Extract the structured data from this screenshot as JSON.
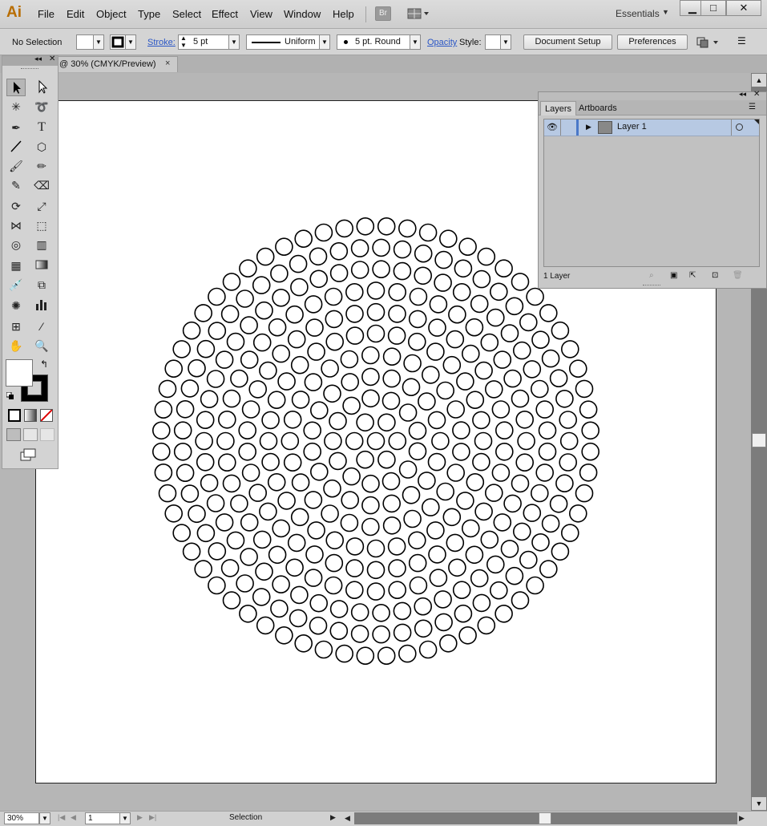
{
  "app": {
    "logo": "Ai",
    "menu": [
      "File",
      "Edit",
      "Object",
      "Type",
      "Select",
      "Effect",
      "View",
      "Window",
      "Help"
    ],
    "bridge_label": "Br",
    "workspace": "Essentials",
    "window_buttons": [
      "minimize-icon",
      "maximize-icon",
      "close-icon"
    ]
  },
  "controlbar": {
    "selection": "No Selection",
    "stroke_label": "Stroke:",
    "stroke_weight": "5 pt",
    "profile": "Uniform",
    "brush": "5 pt. Round",
    "opacity_label": "Opacity",
    "style_label": "Style:",
    "document_setup": "Document Setup",
    "preferences": "Preferences"
  },
  "document": {
    "tab_title": "@ 30% (CMYK/Preview)",
    "tab_close": "×"
  },
  "artwork": {
    "description_shape": "circles",
    "stroke_color": "#000000",
    "fill_color": "#ffffff"
  },
  "layers_panel": {
    "tabs": [
      "Layers",
      "Artboards"
    ],
    "active_tab": "Layers",
    "layers": [
      {
        "name": "Layer 1",
        "visible": true,
        "selected": true,
        "highlight_color": "#b7c9e3"
      }
    ],
    "footer_count": "1 Layer"
  },
  "statusbar": {
    "zoom": "30%",
    "artboard_number": "1",
    "mode": "Selection"
  }
}
